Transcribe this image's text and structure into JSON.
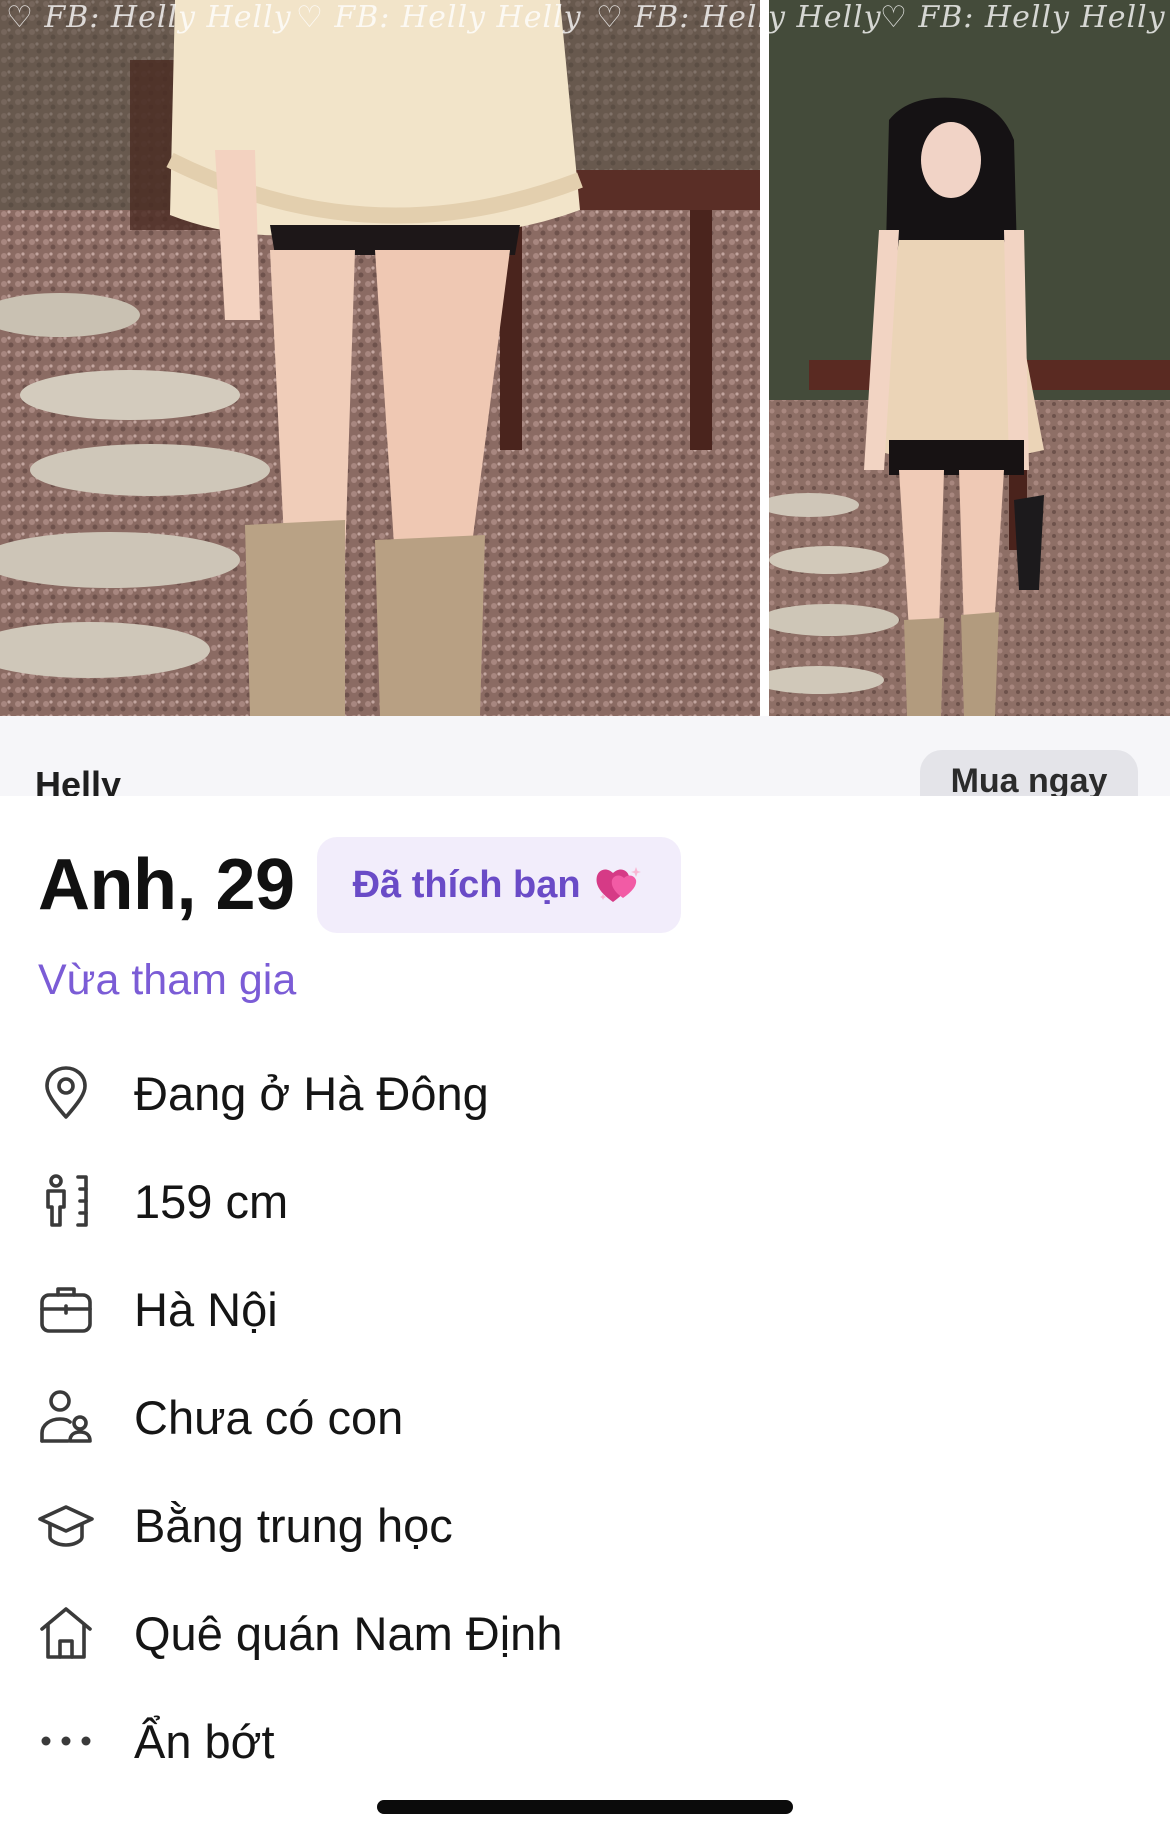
{
  "watermark": {
    "text": "♡ FB: Helly Helly"
  },
  "ad": {
    "brand": "Helly",
    "cta_label": "Mua ngay"
  },
  "profile": {
    "name_age": "Anh, 29",
    "liked_badge": "Đã thích bạn",
    "liked_icon": "sparkling-heart-icon",
    "status": "Vừa tham gia",
    "accent_color": "#7b5cd6",
    "badge_bg_color": "#f2edfb",
    "details": [
      {
        "icon": "location-pin-icon",
        "label": "Đang ở Hà Đông"
      },
      {
        "icon": "height-ruler-icon",
        "label": "159 cm"
      },
      {
        "icon": "briefcase-icon",
        "label": "Hà Nội"
      },
      {
        "icon": "family-icon",
        "label": "Chưa có con"
      },
      {
        "icon": "graduation-cap-icon",
        "label": "Bằng trung học"
      },
      {
        "icon": "home-icon",
        "label": "Quê quán Nam Định"
      },
      {
        "icon": "more-dots-icon",
        "label": "Ẩn bớt"
      }
    ]
  }
}
